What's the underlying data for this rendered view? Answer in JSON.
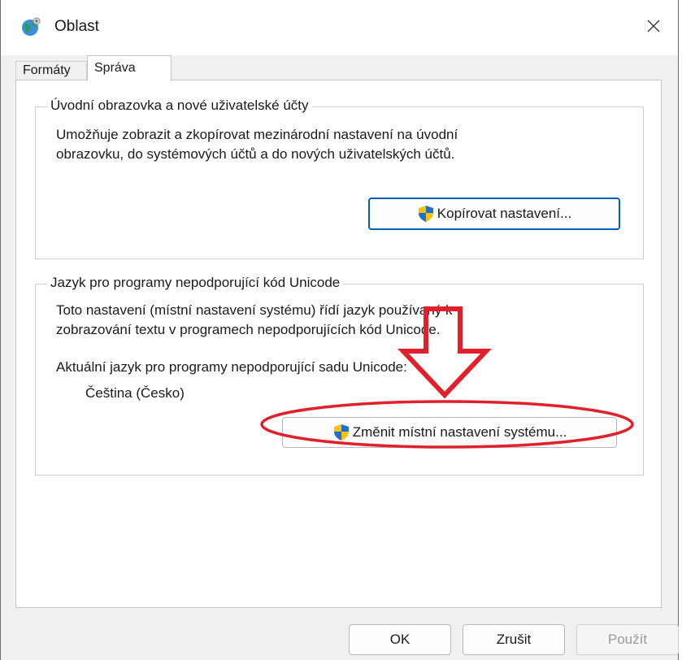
{
  "window": {
    "title": "Oblast",
    "close_glyph": "✕"
  },
  "tabs": [
    {
      "label": "Formáty",
      "active": false
    },
    {
      "label": "Správa",
      "active": true
    }
  ],
  "welcome_group": {
    "legend": "Úvodní obrazovka a nové uživatelské účty",
    "description_line1": "Umožňuje zobrazit a zkopírovat mezinárodní nastavení na úvodní",
    "description_line2": "obrazovku, do systémových účtů a do nových uživatelských účtů.",
    "button_label": "Kopírovat nastavení..."
  },
  "unicode_group": {
    "legend": "Jazyk pro programy nepodporující kód Unicode",
    "description_line1": "Toto nastavení (místní nastavení systému) řídí jazyk používaný k",
    "description_line2": "zobrazování textu v programech nepodporujících kód Unicode.",
    "current_label": "Aktuální jazyk pro programy nepodporující sadu Unicode:",
    "current_value": "Čeština (Česko)",
    "button_label": "Změnit místní nastavení systému..."
  },
  "footer": {
    "ok_label": "OK",
    "cancel_label": "Zrušit",
    "apply_label": "Použít"
  },
  "colors": {
    "annotation": "#e0202a",
    "shield_blue": "#1f6fd1",
    "shield_yellow": "#f4c20d",
    "default_button_border": "#005fb8"
  },
  "icons": {
    "app": "globe-icon",
    "close": "close-icon",
    "uac": "uac-shield-icon",
    "annotation_arrow": "down-arrow-annotation",
    "annotation_ellipse": "highlight-ellipse-annotation"
  }
}
